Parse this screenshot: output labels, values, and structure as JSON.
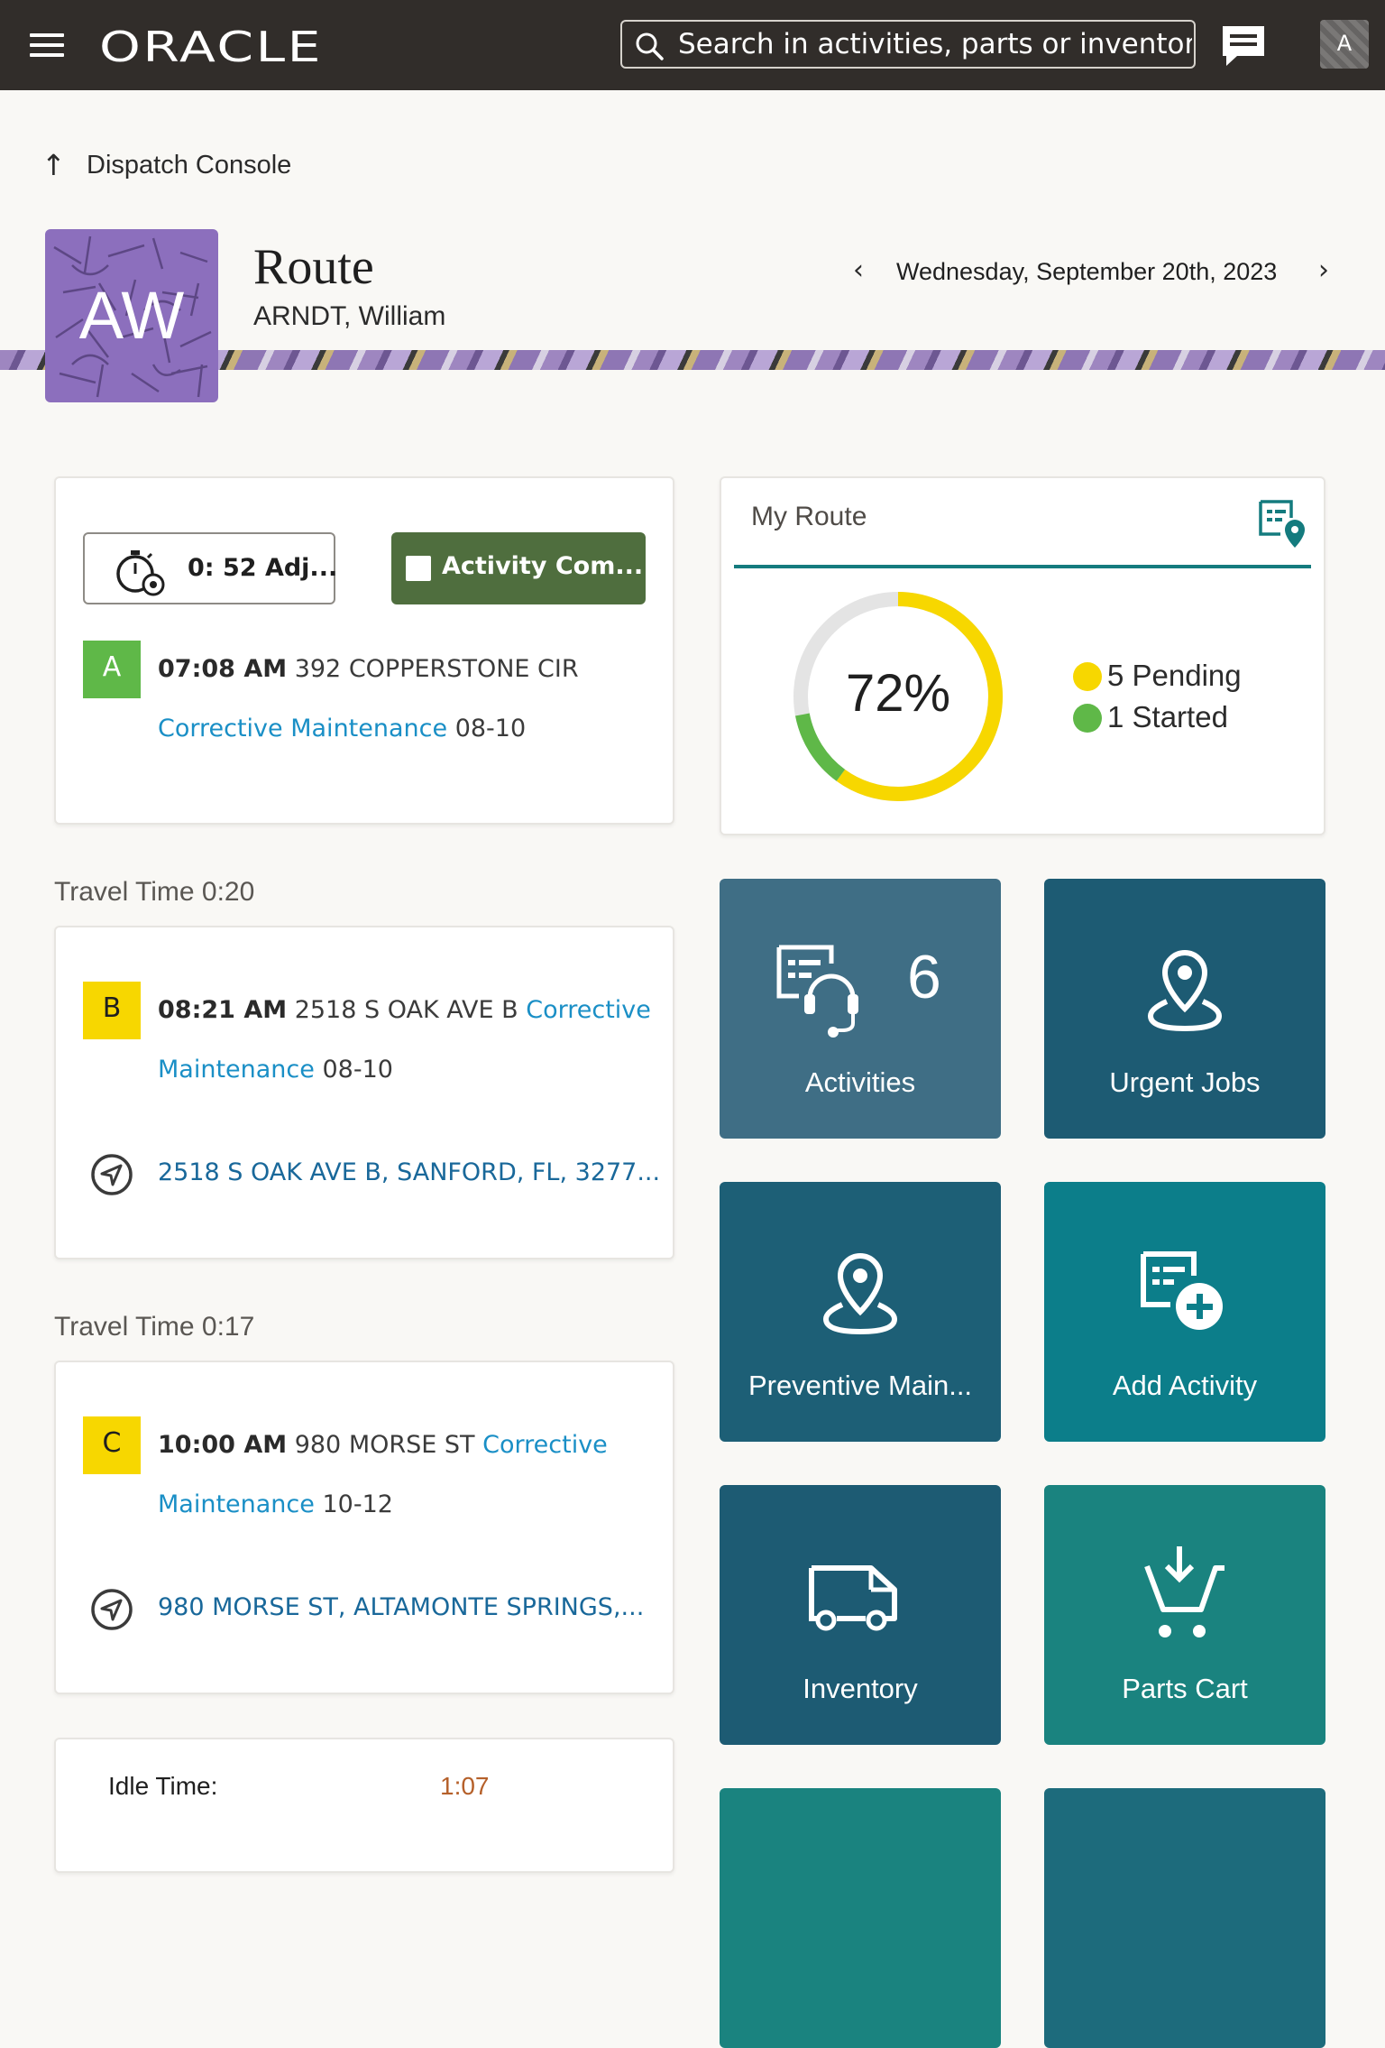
{
  "topbar": {
    "logo": "ORACLE",
    "search_placeholder": "Search in activities, parts or inventories",
    "user_initial": "A"
  },
  "breadcrumb": {
    "label": "Dispatch Console"
  },
  "header": {
    "initials": "AW",
    "title": "Route",
    "technician": "ARNDT, William",
    "date": "Wednesday, September 20th, 2023"
  },
  "current_activity": {
    "timer_label": "0: 52 Adj...",
    "complete_label": "Activity Com...",
    "marker": "A",
    "time": "07:08 AM",
    "address": "392 COPPERSTONE CIR",
    "type": "Corrective Maintenance",
    "window": "08-10"
  },
  "route_stops": [
    {
      "travel": "Travel Time 0:20",
      "marker": "B",
      "time": "08:21 AM",
      "address": "2518 S OAK AVE B",
      "type_line1": "Corrective",
      "type_line2": "Maintenance",
      "window": "08-10",
      "full_address": "2518 S OAK AVE B, SANFORD, FL, 3277..."
    },
    {
      "travel": "Travel Time 0:17",
      "marker": "C",
      "time": "10:00 AM",
      "address": "980 MORSE ST",
      "type_line1": "Corrective",
      "type_line2": "Maintenance",
      "window": "10-12",
      "full_address": "980 MORSE ST, ALTAMONTE SPRINGS,..."
    }
  ],
  "idle": {
    "label": "Idle Time:",
    "value": "1:07"
  },
  "my_route": {
    "title": "My Route",
    "percent_label": "72%",
    "percent": 72,
    "legend": [
      {
        "label": "5 Pending",
        "color": "#f7d700",
        "count": 5
      },
      {
        "label": "1 Started",
        "color": "#5fb848",
        "count": 1
      }
    ]
  },
  "tiles": {
    "activities": {
      "label": "Activities",
      "count": "6",
      "color": "#3f6e85"
    },
    "urgent": {
      "label": "Urgent Jobs",
      "color": "#1d5b73"
    },
    "preventive": {
      "label": "Preventive Main...",
      "color": "#1d5f76"
    },
    "add_activity": {
      "label": "Add Activity",
      "color": "#0c7e8a"
    },
    "inventory": {
      "label": "Inventory",
      "color": "#1d5b73"
    },
    "parts_cart": {
      "label": "Parts Cart",
      "color": "#1a837f"
    }
  }
}
